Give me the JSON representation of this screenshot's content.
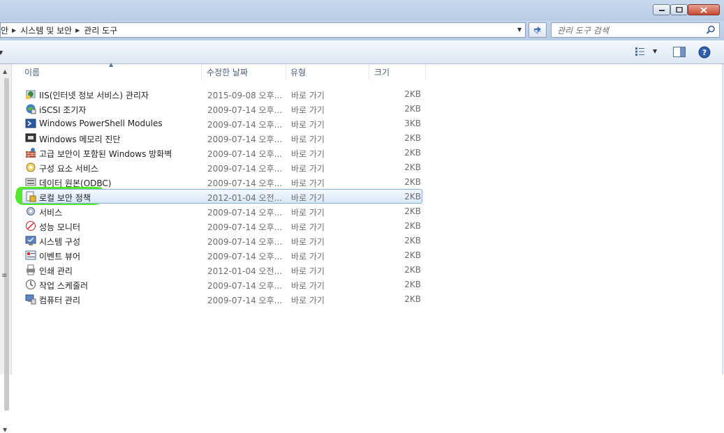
{
  "address": {
    "crumbs": [
      "안",
      "시스템 및 보안",
      "관리 도구"
    ]
  },
  "search": {
    "placeholder": "관리 도구 검색"
  },
  "columns": [
    "이름",
    "수정한 날짜",
    "유형",
    "크기"
  ],
  "items": [
    {
      "name": "IIS(인터넷 정보 서비스) 관리자",
      "date": "2015-09-08 오후...",
      "type": "바로 가기",
      "size": "2KB",
      "icon": "iis-manager-icon"
    },
    {
      "name": "iSCSI 조기자",
      "date": "2009-07-14 오후...",
      "type": "바로 가기",
      "size": "2KB",
      "icon": "iscsi-initiator-icon"
    },
    {
      "name": "Windows PowerShell Modules",
      "date": "2009-07-14 오후...",
      "type": "바로 가기",
      "size": "3KB",
      "icon": "powershell-icon"
    },
    {
      "name": "Windows 메모리 진단",
      "date": "2009-07-14 오후...",
      "type": "바로 가기",
      "size": "2KB",
      "icon": "memory-diagnostic-icon"
    },
    {
      "name": "고급 보안이 포함된 Windows 방화벽",
      "date": "2009-07-14 오후...",
      "type": "바로 가기",
      "size": "2KB",
      "icon": "firewall-icon"
    },
    {
      "name": "구성 요소 서비스",
      "date": "2009-07-14 오후...",
      "type": "바로 가기",
      "size": "2KB",
      "icon": "component-services-icon"
    },
    {
      "name": "데이터 원본(ODBC)",
      "date": "2009-07-14 오후...",
      "type": "바로 가기",
      "size": "2KB",
      "icon": "odbc-icon"
    },
    {
      "name": "로컬 보안 정책",
      "date": "2012-01-04 오전...",
      "type": "바로 가기",
      "size": "2KB",
      "icon": "local-security-policy-icon",
      "selected": true
    },
    {
      "name": "서비스",
      "date": "2009-07-14 오후...",
      "type": "바로 가기",
      "size": "2KB",
      "icon": "services-gear-icon"
    },
    {
      "name": "성능 모니터",
      "date": "2009-07-14 오후...",
      "type": "바로 가기",
      "size": "2KB",
      "icon": "performance-monitor-icon"
    },
    {
      "name": "시스템 구성",
      "date": "2009-07-14 오후...",
      "type": "바로 가기",
      "size": "2KB",
      "icon": "system-configuration-icon"
    },
    {
      "name": "이벤트 뷰어",
      "date": "2009-07-14 오후...",
      "type": "바로 가기",
      "size": "2KB",
      "icon": "event-viewer-icon"
    },
    {
      "name": "인쇄 관리",
      "date": "2012-01-04 오전...",
      "type": "바로 가기",
      "size": "2KB",
      "icon": "print-management-icon"
    },
    {
      "name": "작업 스케줄러",
      "date": "2009-07-14 오후...",
      "type": "바로 가기",
      "size": "2KB",
      "icon": "task-scheduler-icon"
    },
    {
      "name": "컴퓨터 관리",
      "date": "2009-07-14 오후...",
      "type": "바로 가기",
      "size": "2KB",
      "icon": "computer-management-icon"
    }
  ],
  "colors": {
    "selection_border": "#84acdd",
    "highlight_marker": "#33e600",
    "titlebar": "#c9d9ee"
  }
}
